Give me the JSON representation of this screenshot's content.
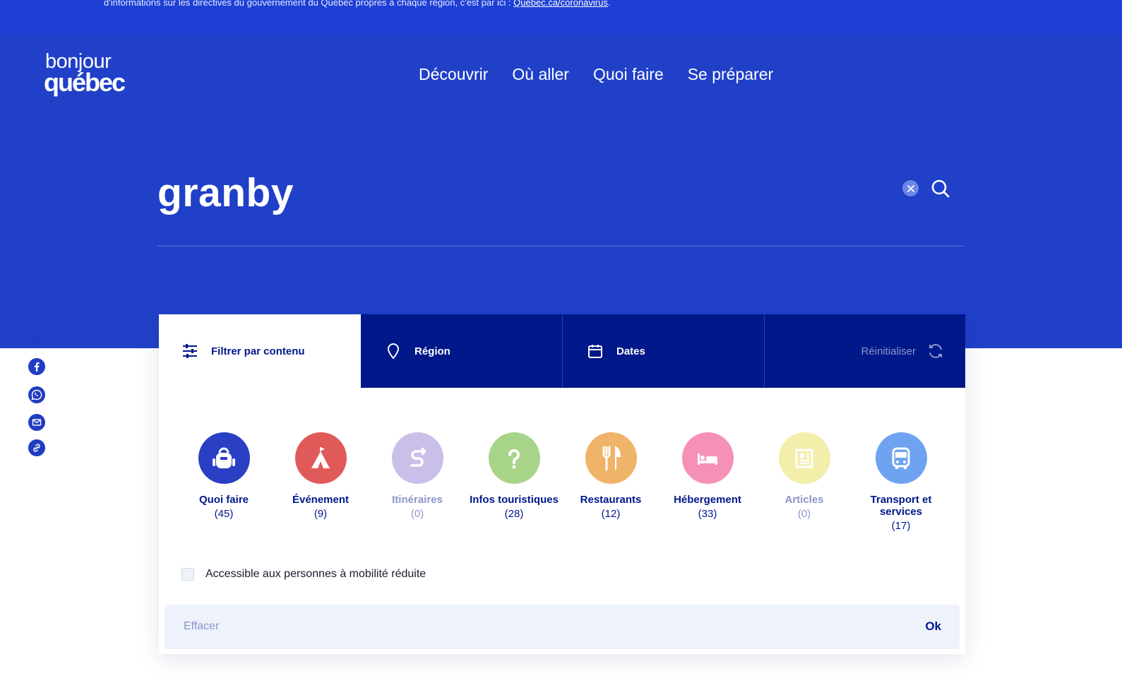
{
  "notice": {
    "text": "d'informations sur les directives du gouvernement du Québec propres à chaque région, c'est par ici : ",
    "link": "Québec.ca/coronavirus",
    "suffix": "."
  },
  "logo": {
    "line1": "bonjour",
    "line2": "québec"
  },
  "nav": [
    "Découvrir",
    "Où aller",
    "Quoi faire",
    "Se préparer"
  ],
  "search": {
    "query": "granby"
  },
  "share": [
    "twitter-icon",
    "facebook-icon",
    "whatsapp-icon",
    "email-icon",
    "link-icon"
  ],
  "filters": {
    "content_label": "Filtrer par contenu",
    "region_label": "Région",
    "dates_label": "Dates",
    "reset_label": "Réinitialiser"
  },
  "categories": [
    {
      "name": "Quoi faire",
      "count": "(45)",
      "color": "#2a3fc4",
      "icon": "backpack-icon",
      "disabled": false
    },
    {
      "name": "Événement",
      "count": "(9)",
      "color": "#e05a5a",
      "icon": "tent-icon",
      "disabled": false
    },
    {
      "name": "Itinéraires",
      "count": "(0)",
      "color": "#c9bfe8",
      "icon": "route-icon",
      "disabled": true
    },
    {
      "name": "Infos touristiques",
      "count": "(28)",
      "color": "#a8d48a",
      "icon": "question-icon",
      "disabled": false
    },
    {
      "name": "Restaurants",
      "count": "(12)",
      "color": "#f0b36a",
      "icon": "fork-knife-icon",
      "disabled": false
    },
    {
      "name": "Hébergement",
      "count": "(33)",
      "color": "#f590b8",
      "icon": "bed-icon",
      "disabled": false
    },
    {
      "name": "Articles",
      "count": "(0)",
      "color": "#f3eeaa",
      "icon": "article-icon",
      "disabled": true
    },
    {
      "name": "Transport et services",
      "count": "(17)",
      "color": "#6fa3f2",
      "icon": "bus-icon",
      "disabled": false
    }
  ],
  "accessibility_label": "Accessible aux personnes à mobilité réduite",
  "footer": {
    "clear_label": "Effacer",
    "ok_label": "Ok"
  }
}
